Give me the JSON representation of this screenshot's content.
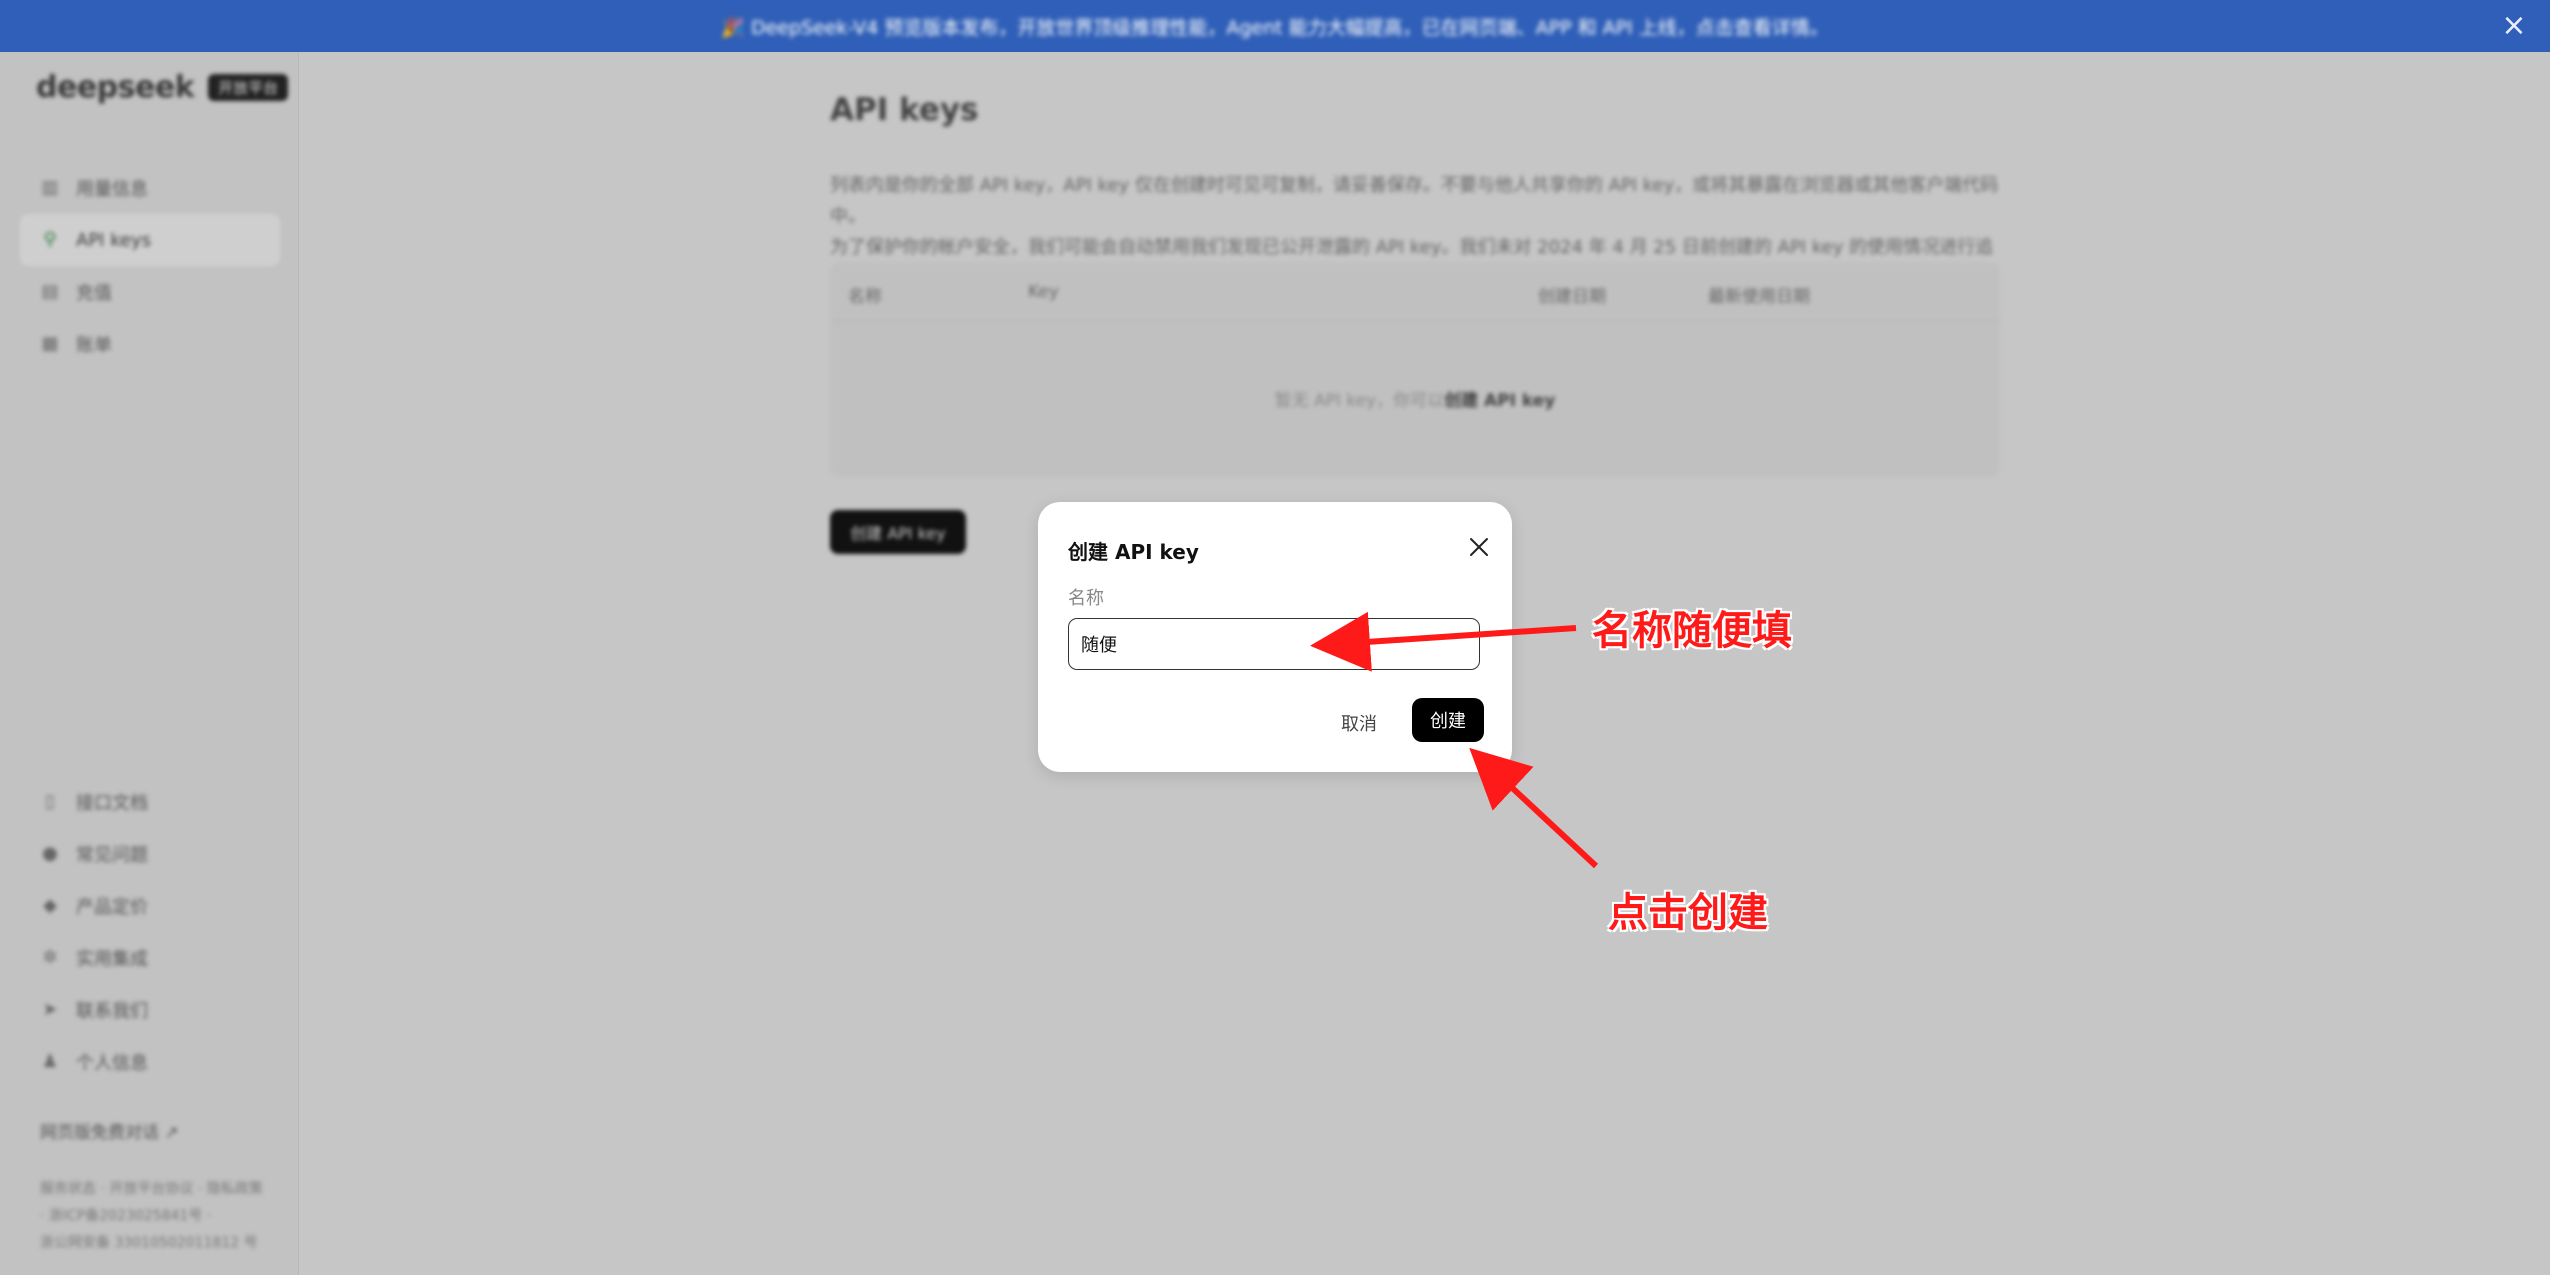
{
  "banner": {
    "text": "🎉 DeepSeek-V4 预览版本发布，开放世界顶级推理性能，Agent 能力大幅提高，已在网页端、APP 和 API 上线，点击查看详情。",
    "close_icon": "close-icon"
  },
  "sidebar": {
    "logo_text": "deepseek",
    "logo_badge": "开放平台",
    "top_items": [
      {
        "label": "用量信息",
        "icon": "bar-chart-icon",
        "glyph": "▥"
      },
      {
        "label": "API keys",
        "icon": "search-key-icon",
        "glyph": "⚲"
      },
      {
        "label": "充值",
        "icon": "wallet-icon",
        "glyph": "▤"
      },
      {
        "label": "账单",
        "icon": "bill-icon",
        "glyph": "▦"
      }
    ],
    "bottom_items": [
      {
        "label": "接口文档",
        "icon": "document-icon",
        "glyph": "▯"
      },
      {
        "label": "常见问题",
        "icon": "question-icon",
        "glyph": "●"
      },
      {
        "label": "产品定价",
        "icon": "tag-icon",
        "glyph": "◆"
      },
      {
        "label": "实用集成",
        "icon": "integration-icon",
        "glyph": "✲"
      },
      {
        "label": "联系我们",
        "icon": "send-icon",
        "glyph": "➤"
      },
      {
        "label": "个人信息",
        "icon": "user-icon",
        "glyph": "♟"
      }
    ],
    "web_chat_link": "网页版免费对话 ↗",
    "legal_lines": [
      "服务状态 · 开放平台协议 · 隐私政策",
      "· 浙ICP备2023025841号 ·",
      "浙公网安备 33010502011812 号"
    ]
  },
  "main": {
    "title": "API keys",
    "description_lines": [
      "列表内是你的全部 API key，API key 仅在创建时可见可复制，请妥善保存。不要与他人共享你的 API key，或将其暴露在浏览器或其他客户端代码中。",
      "为了保护你的帐户安全，我们可能会自动禁用我们发现已公开泄露的 API key。我们未对 2024 年 4 月 25 日前创建的 API key 的使用情况进行追踪。"
    ],
    "table_headers": [
      "名称",
      "Key",
      "创建日期",
      "最新使用日期"
    ],
    "empty_prefix": "暂无 API key，你可以",
    "empty_action": "创建 API key",
    "create_button": "创建 API key"
  },
  "modal": {
    "title": "创建 API key",
    "field_label": "名称",
    "name_value": "随便",
    "cancel_label": "取消",
    "create_label": "创建"
  },
  "annotations": {
    "name_hint": "名称随便填",
    "click_hint": "点击创建",
    "color": "#ff1a1a"
  }
}
